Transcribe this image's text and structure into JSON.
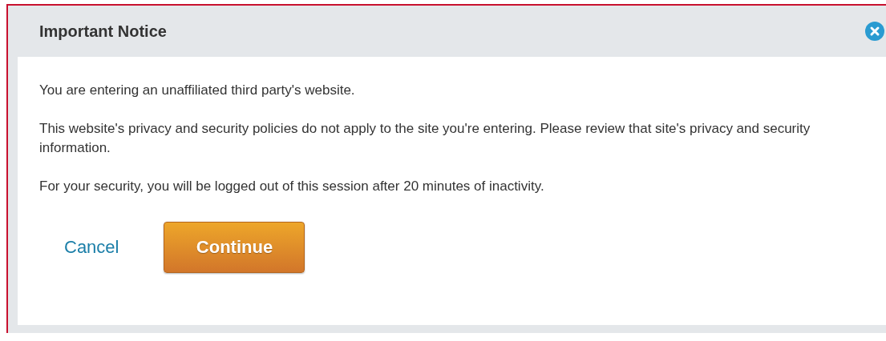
{
  "dialog": {
    "title": "Important Notice",
    "paragraphs": [
      "You are entering an unaffiliated third party's website.",
      "This website's privacy and security policies do not apply to the site you're entering. Please review that site's privacy and security information.",
      "For your security, you will be logged out of this session after 20 minutes of inactivity."
    ],
    "buttons": [
      {
        "label": "Cancel",
        "kind": "link"
      },
      {
        "label": "Continue",
        "kind": "primary"
      }
    ]
  }
}
